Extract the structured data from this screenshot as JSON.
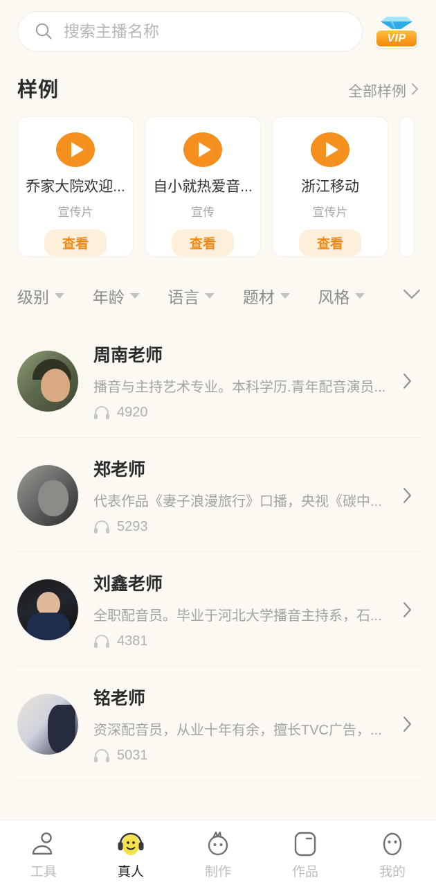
{
  "search": {
    "placeholder": "搜索主播名称",
    "value": "",
    "icon": "search-icon"
  },
  "vip": {
    "label": "VIP",
    "icon": "diamond-icon",
    "plate_color": "#F79A1B",
    "gem_color": "#3FB8F0"
  },
  "samples": {
    "title": "样例",
    "more_label": "全部样例",
    "more_chevron": "›",
    "cards": [
      {
        "title": "乔家大院欢迎...",
        "subtitle": "宣传片",
        "button": "查看",
        "play_icon": "play-icon"
      },
      {
        "title": "自小就热爱音...",
        "subtitle": "宣传",
        "button": "查看",
        "play_icon": "play-icon"
      },
      {
        "title": "浙江移动",
        "subtitle": "宣传片",
        "button": "查看",
        "play_icon": "play-icon"
      }
    ]
  },
  "filters": {
    "items": [
      {
        "label": "级别"
      },
      {
        "label": "年龄"
      },
      {
        "label": "语言"
      },
      {
        "label": "题材"
      },
      {
        "label": "风格"
      }
    ],
    "expand_icon": "chevron-down-icon"
  },
  "anchors": [
    {
      "name": "周南老师",
      "desc": "播音与主持艺术专业。本科学历.青年配音演员...",
      "plays": "4920",
      "plays_icon": "headphone-icon",
      "chevron": "›"
    },
    {
      "name": "郑老师",
      "desc": "代表作品《妻子浪漫旅行》口播，央视《碳中...",
      "plays": "5293",
      "plays_icon": "headphone-icon",
      "chevron": "›"
    },
    {
      "name": "刘鑫老师",
      "desc": "全职配音员。毕业于河北大学播音主持系，石...",
      "plays": "4381",
      "plays_icon": "headphone-icon",
      "chevron": "›"
    },
    {
      "name": "铭老师",
      "desc": "资深配音员，从业十年有余，擅长TVC广告，...",
      "plays": "5031",
      "plays_icon": "headphone-icon",
      "chevron": "›"
    }
  ],
  "tabbar": {
    "active_index": 1,
    "items": [
      {
        "label": "工具",
        "icon": "person-icon"
      },
      {
        "label": "真人",
        "icon": "headset-face-icon"
      },
      {
        "label": "制作",
        "icon": "face-tuft-icon"
      },
      {
        "label": "作品",
        "icon": "card-icon"
      },
      {
        "label": "我的",
        "icon": "face-oval-icon"
      }
    ]
  },
  "colors": {
    "background": "#FCF8F2",
    "accent_orange": "#F5901E",
    "button_bg": "#FDEFD9",
    "active_tab": "#F5E14B"
  }
}
